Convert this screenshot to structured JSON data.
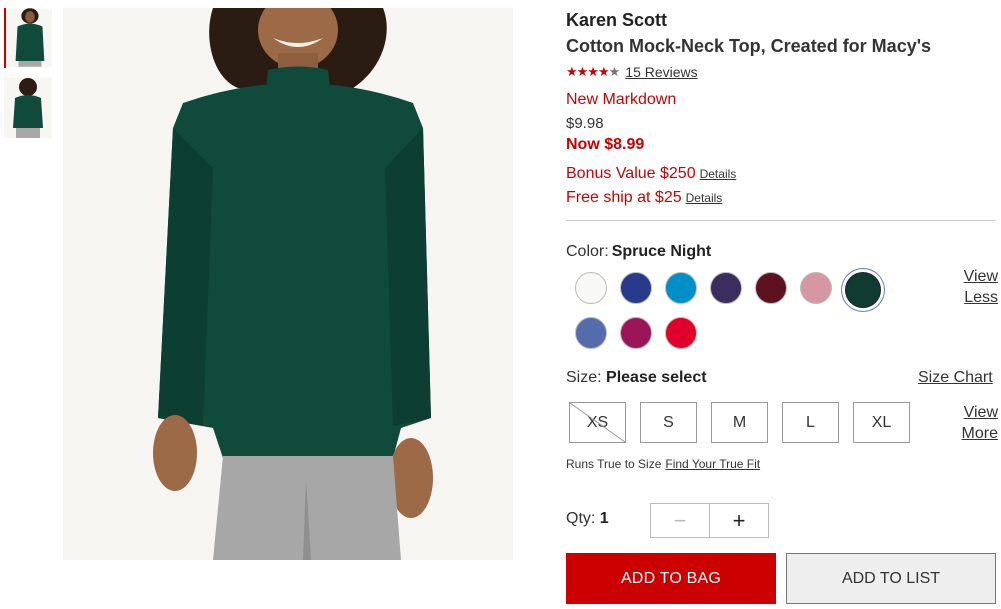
{
  "product": {
    "brand": "Karen Scott",
    "name": "Cotton Mock-Neck Top, Created for Macy's",
    "rating_stars": 4,
    "reviews_label": "15 Reviews",
    "markdown_label": "New Markdown",
    "original_price": "$9.98",
    "now_price": "Now $8.99",
    "bonus_text": "Bonus Value $250",
    "bonus_details": "Details",
    "freeship_text": "Free ship at $25",
    "freeship_details": "Details"
  },
  "color": {
    "label": "Color:",
    "selected": "Spruce Night",
    "view_less_1": "View",
    "view_less_2": "Less",
    "swatches": [
      {
        "name": "white",
        "hex": "#f8f8f6"
      },
      {
        "name": "navy",
        "hex": "#283a8c"
      },
      {
        "name": "turquoise",
        "hex": "#008fc6"
      },
      {
        "name": "purple",
        "hex": "#3b2d5e"
      },
      {
        "name": "burgundy",
        "hex": "#5e1220"
      },
      {
        "name": "pink",
        "hex": "#d796a4"
      },
      {
        "name": "spruce-night",
        "hex": "#0f3b31"
      },
      {
        "name": "denim",
        "hex": "#546cab"
      },
      {
        "name": "magenta",
        "hex": "#9c1558"
      },
      {
        "name": "red",
        "hex": "#e0002a"
      }
    ]
  },
  "size": {
    "label": "Size:",
    "selected": "Please select",
    "chart_label": "Size Chart",
    "options": [
      "XS",
      "S",
      "M",
      "L",
      "XL"
    ],
    "view_more_1": "View",
    "view_more_2": "More",
    "fit_text": "Runs True to Size",
    "fit_link": "Find Your True Fit"
  },
  "qty": {
    "label": "Qty:",
    "value": "1",
    "minus": "−",
    "plus": "+"
  },
  "actions": {
    "add_to_bag": "ADD TO BAG",
    "add_to_list": "ADD TO LIST"
  },
  "colors": {
    "accent_red": "#cc0000",
    "garment": "#0f4a3a"
  }
}
